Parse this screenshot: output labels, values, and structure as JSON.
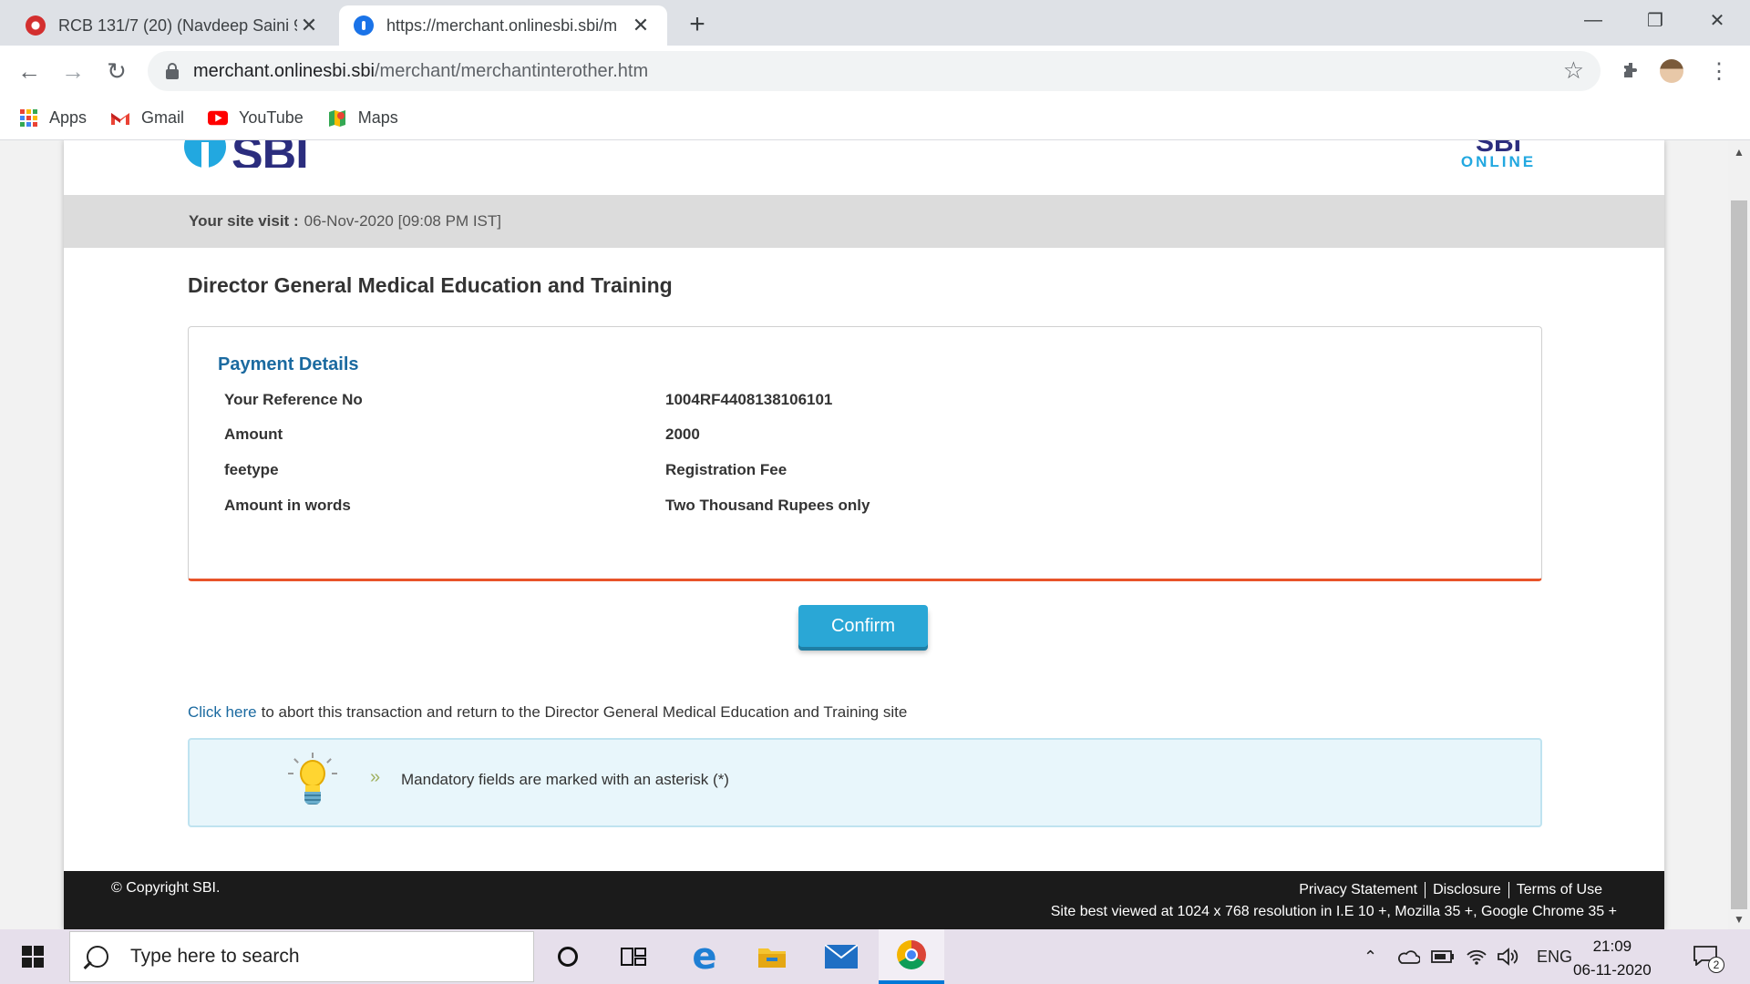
{
  "browser": {
    "tabs": [
      {
        "title": "RCB 131/7 (20) (Navdeep Saini 9(",
        "close": "✕"
      },
      {
        "title": "https://merchant.onlinesbi.sbi/m",
        "close": "✕"
      }
    ],
    "new_tab": "+",
    "window_controls": {
      "minimize": "—",
      "restore": "❐",
      "close": "✕"
    },
    "nav": {
      "back": "←",
      "forward": "→",
      "reload": "↻"
    },
    "url": {
      "host": "merchant.onlinesbi.sbi",
      "path": "/merchant/merchantinterother.htm"
    },
    "bookmarks": [
      {
        "label": "Apps",
        "icon": "apps-grid-icon"
      },
      {
        "label": "Gmail",
        "icon": "gmail-icon"
      },
      {
        "label": "YouTube",
        "icon": "youtube-icon"
      },
      {
        "label": "Maps",
        "icon": "maps-icon"
      }
    ]
  },
  "page": {
    "logo_left": "SBI",
    "logo_right_top": "SBI",
    "logo_right_bottom": "ONLINE",
    "visit_label": "Your site visit :",
    "visit_value": "06-Nov-2020 [09:08 PM IST]",
    "merchant_title": "Director General Medical Education and Training",
    "payment_details": {
      "heading": "Payment Details",
      "rows": [
        {
          "label": "Your Reference No",
          "value": "1004RF4408138106101"
        },
        {
          "label": "Amount",
          "value": "2000"
        },
        {
          "label": "feetype",
          "value": "Registration Fee"
        },
        {
          "label": "Amount in words",
          "value": "Two Thousand Rupees only"
        }
      ]
    },
    "confirm_label": "Confirm",
    "abort_link": "Click here",
    "abort_text": "to abort this transaction and return to the Director General Medical Education and Training site",
    "info_chevron": "»",
    "info_message": "Mandatory fields are marked with an asterisk (*)",
    "footer": {
      "copyright": "© Copyright SBI.",
      "links": [
        "Privacy Statement",
        "Disclosure",
        "Terms of Use"
      ],
      "best_viewed": "Site best viewed at 1024 x 768 resolution in I.E 10 +, Mozilla 35 +, Google Chrome 35 +"
    }
  },
  "taskbar": {
    "search_placeholder": "Type here to search",
    "language": "ENG",
    "time": "21:09",
    "date": "06-11-2020",
    "notification_count": "2"
  },
  "colors": {
    "sbi_blue": "#22a8e0",
    "sbi_navy": "#2b2d7e",
    "heading_blue": "#1b6aa0",
    "accent_orange": "#e8542a",
    "confirm_button": "#2aa7d6"
  }
}
